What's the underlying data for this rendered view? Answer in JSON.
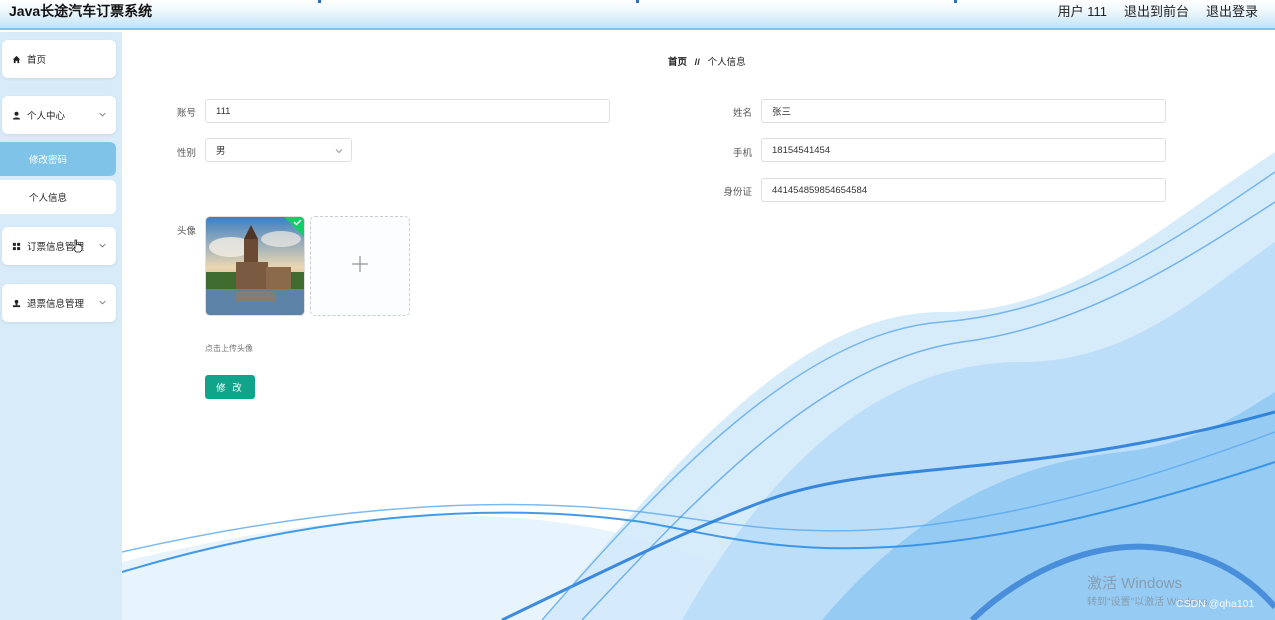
{
  "app": {
    "title": "Java长途汽车订票系统",
    "user_label": "用户 111",
    "exit_front": "退出到前台",
    "logout": "退出登录"
  },
  "sidebar": {
    "home": "首页",
    "personal_center": "个人中心",
    "change_password": "修改密码",
    "personal_info": "个人信息",
    "booking_mgmt": "订票信息管理",
    "refund_mgmt": "退票信息管理"
  },
  "breadcrumb": {
    "home": "首页",
    "separator": "//",
    "current": "个人信息"
  },
  "form": {
    "account_label": "账号",
    "account_value": "111",
    "name_label": "姓名",
    "name_value": "张三",
    "gender_label": "性别",
    "gender_value": "男",
    "phone_label": "手机",
    "phone_value": "18154541454",
    "idcard_label": "身份证",
    "idcard_value": "441454859854654584",
    "avatar_label": "头像",
    "upload_hint": "点击上传头像",
    "submit_label": "修 改"
  },
  "watermark": {
    "windows": "激活 Windows",
    "windows_sub": "转到\"设置\"以激活 Windows。",
    "csdn": "CSDN @qha101"
  },
  "colors": {
    "accent": "#10a58b",
    "sidebar_bg": "#d7ecf8",
    "sidebar_active": "#7fc3e8",
    "wave": "#2f8fe6"
  }
}
